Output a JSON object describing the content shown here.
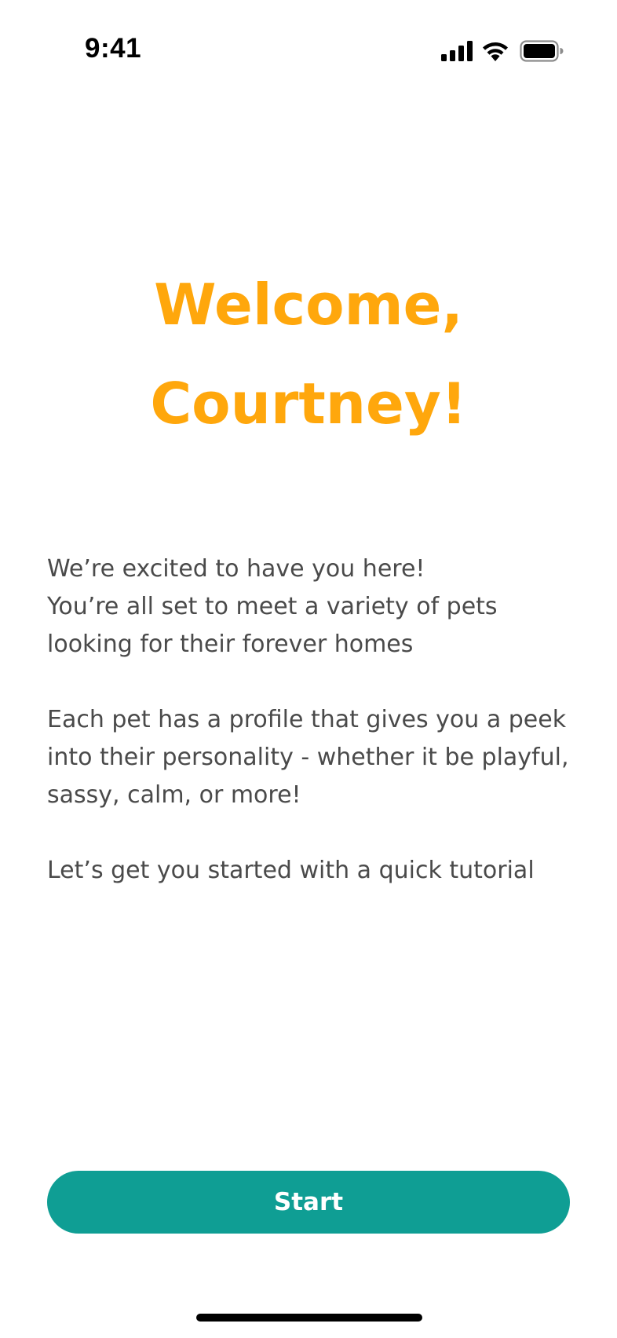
{
  "status_bar": {
    "time": "9:41",
    "icons": [
      "signal-icon",
      "wifi-icon",
      "battery-icon"
    ]
  },
  "welcome": {
    "line1": "Welcome,",
    "line2": "Courtney!"
  },
  "intro": {
    "paragraph1": "We’re excited to have you here!\nYou’re all set to meet a variety of pets\nlooking for their forever homes",
    "paragraph2": "Each pet has a profile that gives you a peek\ninto their personality - whether it be playful,\nsassy, calm, or more!",
    "paragraph3": "Let’s get you started with a quick tutorial"
  },
  "actions": {
    "start_label": "Start"
  },
  "colors": {
    "accent_title": "#ffa70c",
    "primary_button": "#0f9e94",
    "body_text": "#4a4a4a"
  }
}
